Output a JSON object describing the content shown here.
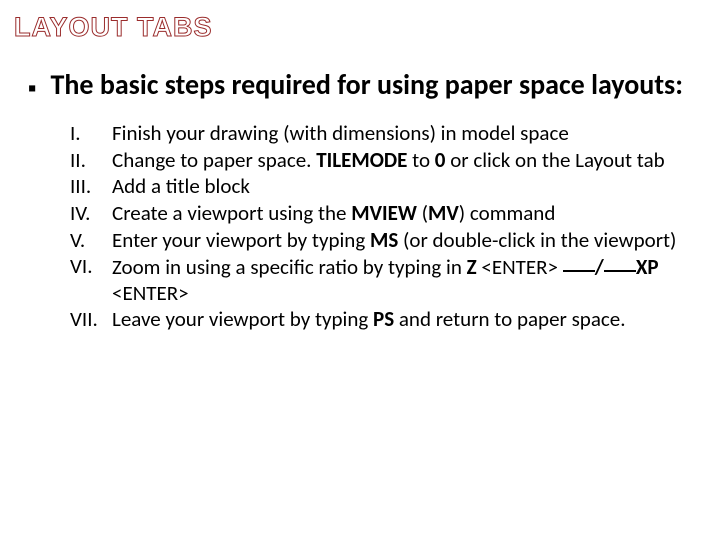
{
  "title": "LAYOUT TABS",
  "intro": "The basic steps required for using paper space layouts:",
  "steps": {
    "n1": "I.",
    "t1": "Finish your drawing (with dimensions) in model space",
    "n2": "II.",
    "t2a": "Change to paper space. ",
    "t2b": "TILEMODE",
    "t2c": " to ",
    "t2d": "0",
    "t2e": " or click on the Layout tab",
    "n3": "III.",
    "t3": "Add a title block",
    "n4": "IV.",
    "t4a": "Create a viewport using the ",
    "t4b": "MVIEW",
    "t4c": " (",
    "t4d": "MV",
    "t4e": ") command",
    "n5": "V.",
    "t5a": "Enter your viewport by typing ",
    "t5b": "MS",
    "t5c": " (or double-click in the viewport)",
    "n6": "VI.",
    "t6a": "Zoom in using a specific ratio by typing in ",
    "t6b": "Z",
    "t6c": " <ENTER> ",
    "t6d": "/",
    "t6e": "XP",
    "t6f": " <ENTER>",
    "n7": "VII.",
    "t7a": "Leave your viewport by typing ",
    "t7b": "PS",
    "t7c": " and return to paper space."
  }
}
